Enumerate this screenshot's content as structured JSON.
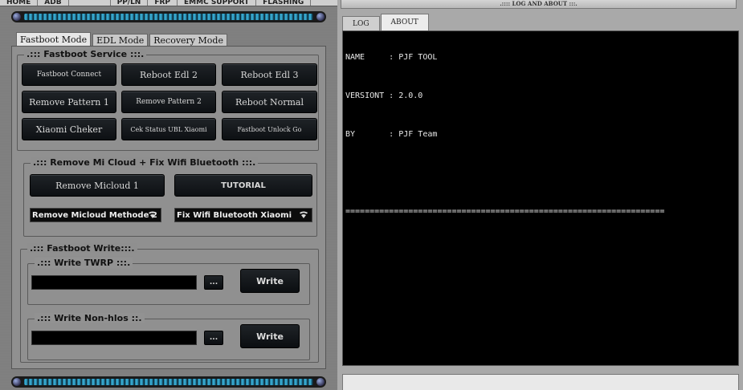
{
  "top_menu": [
    "HOME",
    "ADB",
    "",
    "PP/LN",
    "FRP",
    "EMMC SUPPORT",
    "FLASHING"
  ],
  "modes": {
    "tabs": [
      "Fastboot Mode",
      "EDL Mode",
      "Recovery Mode"
    ],
    "active": "Fastboot Mode"
  },
  "fastboot_service": {
    "title": ".::: Fastboot Service :::.",
    "buttons": [
      "Fastboot Connect",
      "Reboot Edl 2",
      "Reboot Edl 3",
      "Remove Pattern 1",
      "Remove Pattern 2",
      "Reboot Normal",
      "Xiaomi Cheker",
      "Cek Status UBL Xiaomi",
      "Fastboot Unlock Go"
    ]
  },
  "micloud": {
    "title": ".::: Remove Mi Cloud + Fix Wifi Bluetooth :::.",
    "remove_button": "Remove Micloud 1",
    "tutorial_button": "TUTORIAL",
    "method_select": "Remove Micloud Methode 2",
    "wifi_select": "Fix Wifi Bluetooth Xiaomi"
  },
  "fastboot_write": {
    "title": ".::: Fastboot Write:::.",
    "twrp": {
      "title": ".::: Write TWRP :::.",
      "browse": "...",
      "write": "Write"
    },
    "nonhlos": {
      "title": ".::: Write Non-hlos ::.",
      "browse": "...",
      "write": "Write"
    }
  },
  "log_panel": {
    "header": ".:::: LOG AND ABOUT :::.",
    "tabs": [
      "LOG",
      "ABOUT"
    ],
    "active_tab": "ABOUT",
    "lines": [
      "NAME     : PJF TOOL",
      "VERSIONT : 2.0.0",
      "BY       : PJF Team"
    ],
    "separator": "=================================================================="
  },
  "colors": {
    "accent_led": "#3fb7de",
    "console_bg": "#000000",
    "button_bg": "#15191c"
  }
}
